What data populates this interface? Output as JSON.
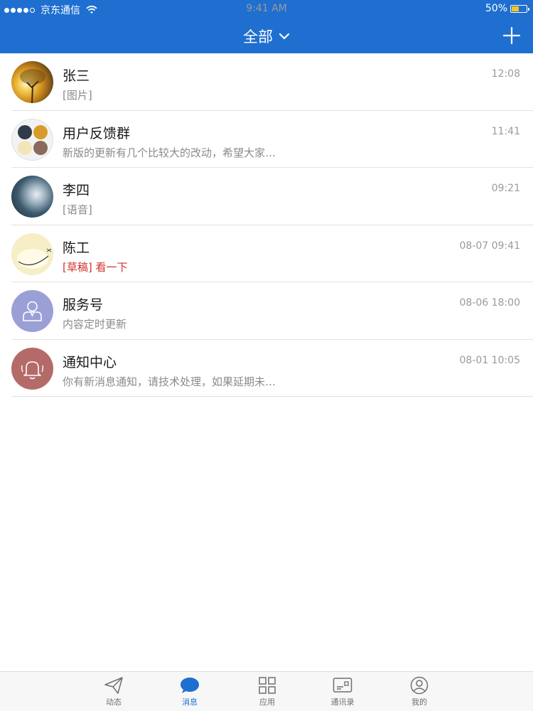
{
  "status_bar": {
    "carrier": "京东通信",
    "time": "9:41 AM",
    "battery": "50%",
    "battery_level": 0.5
  },
  "header": {
    "title": "全部",
    "dropdown_icon": "chevron-down-icon",
    "add_icon": "plus-icon"
  },
  "conversations": [
    {
      "name": "张三",
      "preview": "[图片]",
      "time": "12:08",
      "avatar": "photo-tree-sunset"
    },
    {
      "name": "用户反馈群",
      "preview": "新版的更新有几个比较大的改动，希望大家…",
      "time": "11:41",
      "avatar": "group-avatar"
    },
    {
      "name": "李四",
      "preview": "[语音]",
      "time": "09:21",
      "avatar": "photo-portrait"
    },
    {
      "name": "陈工",
      "preview_draft": "[草稿]",
      "preview": "看一下",
      "time": "08-07 09:41",
      "avatar": "drawing-bird"
    },
    {
      "name": "服务号",
      "preview": "内容定时更新",
      "time": "08-06 18:00",
      "avatar": "person-icon"
    },
    {
      "name": "通知中心",
      "preview": "你有新消息通知，请技术处理，如果延期未…",
      "time": "08-01 10:05",
      "avatar": "bell-icon"
    }
  ],
  "tabs": [
    {
      "label": "动态",
      "icon": "paper-plane-icon"
    },
    {
      "label": "消息",
      "icon": "chat-bubble-icon",
      "active": true
    },
    {
      "label": "应用",
      "icon": "grid-icon"
    },
    {
      "label": "通讯录",
      "icon": "contact-card-icon"
    },
    {
      "label": "我的",
      "icon": "user-circle-icon"
    }
  ],
  "colors": {
    "brand": "#1f6fd0",
    "draft": "#d0312d",
    "battery": "#f7c51e"
  }
}
